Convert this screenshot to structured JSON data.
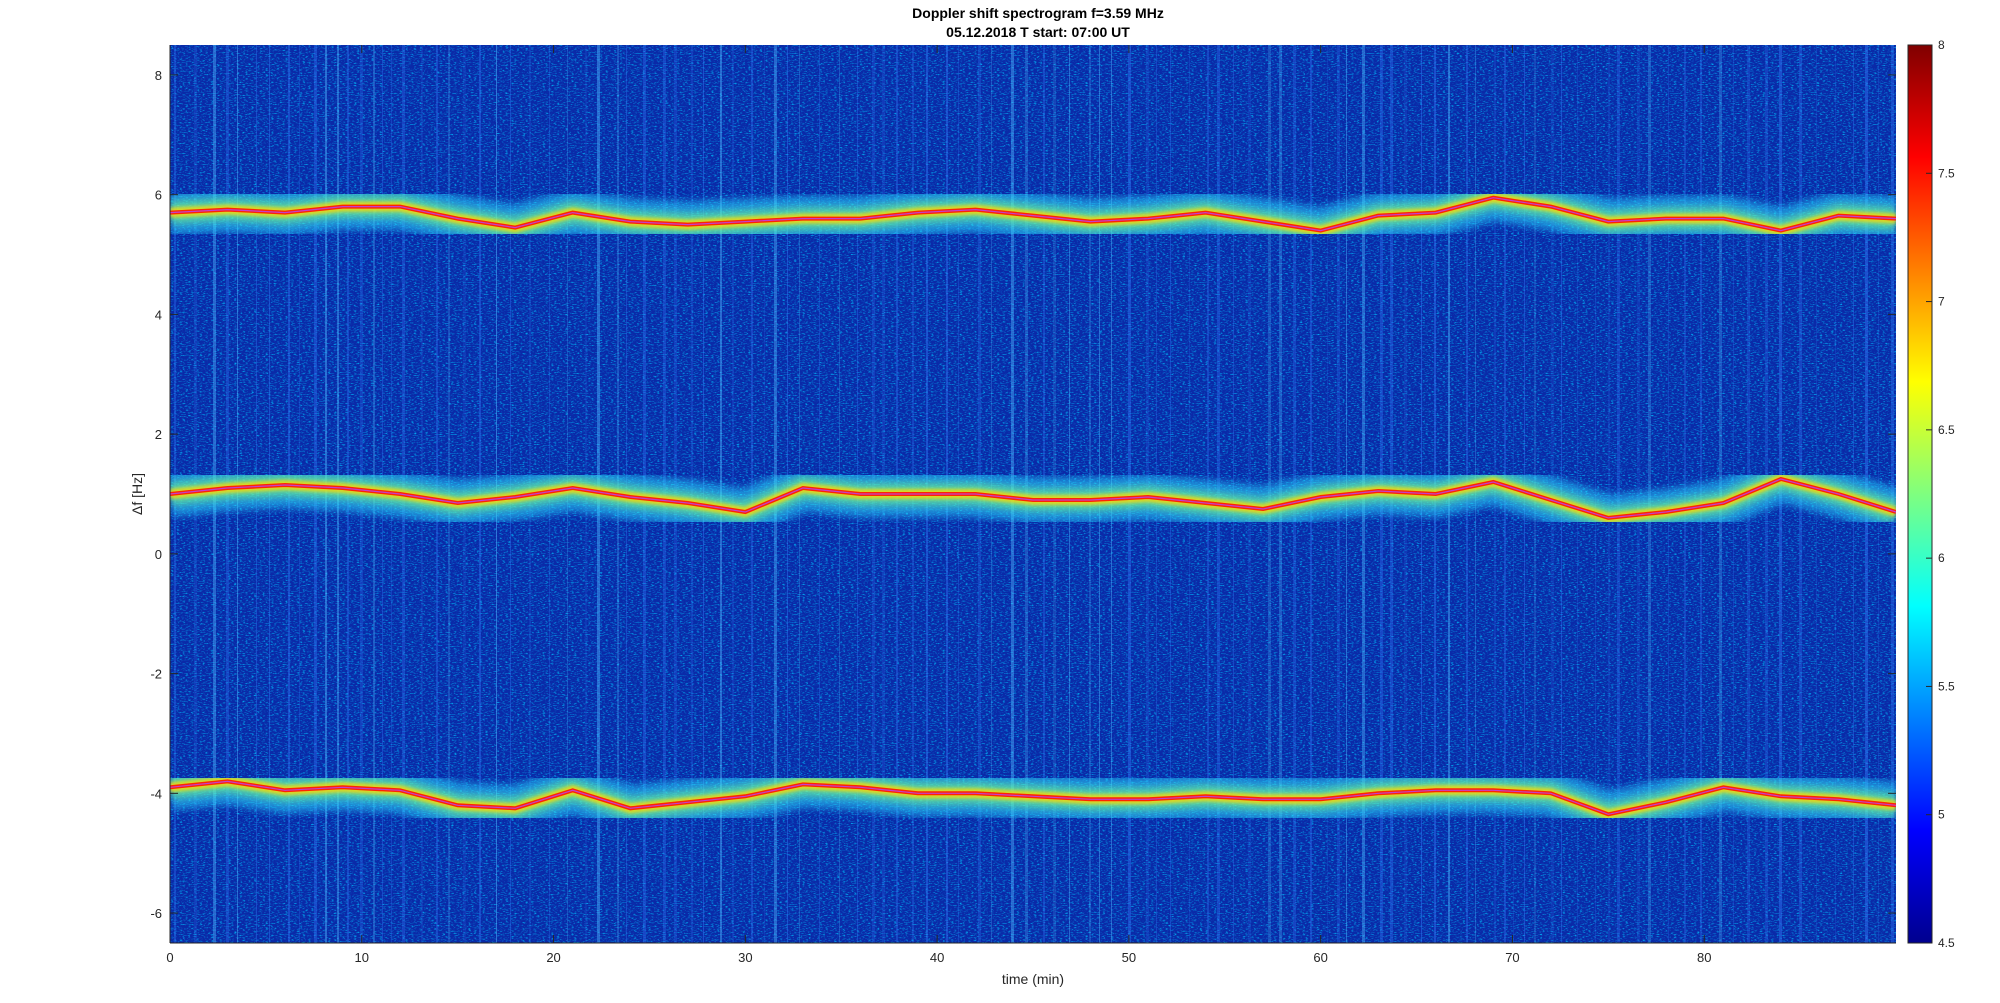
{
  "chart_data": {
    "type": "heatmap",
    "title": "Doppler shift spectrogram f=3.59 MHz",
    "subtitle": "05.12.2018   T start: 07:00 UT",
    "xlabel": "time (min)",
    "ylabel": "Δf [Hz]",
    "xlim": [
      0,
      90
    ],
    "ylim": [
      -6.5,
      8.5
    ],
    "x_ticks": [
      0,
      10,
      20,
      30,
      40,
      50,
      60,
      70,
      80
    ],
    "y_ticks": [
      -6,
      -4,
      -2,
      0,
      2,
      4,
      6,
      8
    ],
    "colorbar": {
      "range": [
        4.5,
        8
      ],
      "ticks": [
        4.5,
        5,
        5.5,
        6,
        6.5,
        7,
        7.5,
        8
      ],
      "tick_labels": [
        "4.5",
        "5",
        "5.5",
        "6",
        "6.5",
        "7",
        "7.5",
        "8"
      ],
      "colormap": "jet"
    },
    "series": [
      {
        "x": [
          0,
          3,
          6,
          9,
          12,
          15,
          18,
          21,
          24,
          27,
          30,
          33,
          36,
          39,
          42,
          45,
          48,
          51,
          54,
          57,
          60,
          63,
          66,
          69,
          72,
          75,
          78,
          81,
          84,
          87,
          90
        ],
        "y": [
          5.7,
          5.75,
          5.7,
          5.8,
          5.8,
          5.6,
          5.45,
          5.7,
          5.55,
          5.5,
          5.55,
          5.6,
          5.6,
          5.7,
          5.75,
          5.65,
          5.55,
          5.6,
          5.7,
          5.55,
          5.4,
          5.65,
          5.7,
          5.95,
          5.8,
          5.55,
          5.6,
          5.6,
          5.4,
          5.65,
          5.6
        ]
      },
      {
        "x": [
          0,
          3,
          6,
          9,
          12,
          15,
          18,
          21,
          24,
          27,
          30,
          33,
          36,
          39,
          42,
          45,
          48,
          51,
          54,
          57,
          60,
          63,
          66,
          69,
          72,
          75,
          78,
          81,
          84,
          87,
          90
        ],
        "y": [
          1.0,
          1.1,
          1.15,
          1.1,
          1.0,
          0.85,
          0.95,
          1.1,
          0.95,
          0.85,
          0.7,
          1.1,
          1.0,
          1.0,
          1.0,
          0.9,
          0.9,
          0.95,
          0.85,
          0.75,
          0.95,
          1.05,
          1.0,
          1.2,
          0.9,
          0.6,
          0.7,
          0.85,
          1.25,
          1.0,
          0.7
        ]
      },
      {
        "x": [
          0,
          3,
          6,
          9,
          12,
          15,
          18,
          21,
          24,
          27,
          30,
          33,
          36,
          39,
          42,
          45,
          48,
          51,
          54,
          57,
          60,
          63,
          66,
          69,
          72,
          75,
          78,
          81,
          84,
          87,
          90
        ],
        "y": [
          -3.9,
          -3.8,
          -3.95,
          -3.9,
          -3.95,
          -4.2,
          -4.25,
          -3.95,
          -4.25,
          -4.15,
          -4.05,
          -3.85,
          -3.9,
          -4.0,
          -4.0,
          -4.05,
          -4.1,
          -4.1,
          -4.05,
          -4.1,
          -4.1,
          -4.0,
          -3.95,
          -3.95,
          -4.0,
          -4.35,
          -4.15,
          -3.9,
          -4.05,
          -4.1,
          -4.2
        ]
      }
    ]
  }
}
